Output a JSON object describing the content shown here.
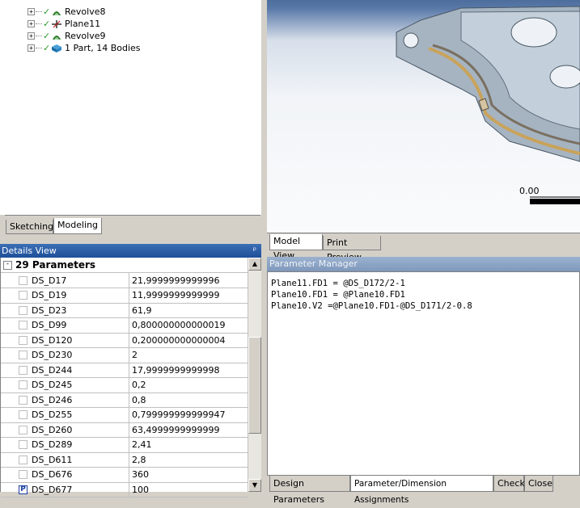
{
  "tree": {
    "items": [
      {
        "label": "Revolve8",
        "icon": "revolve-icon"
      },
      {
        "label": "Plane11",
        "icon": "plane-icon"
      },
      {
        "label": "Revolve9",
        "icon": "revolve-icon"
      },
      {
        "label": "1 Part, 14 Bodies",
        "icon": "parts-icon"
      }
    ]
  },
  "left_tabs": {
    "sketching": "Sketching",
    "modeling": "Modeling"
  },
  "details": {
    "title": "Details View",
    "group": "29 Parameters",
    "rows": [
      {
        "name": "DS_D17",
        "value": "21,9999999999996",
        "p": false
      },
      {
        "name": "DS_D19",
        "value": "11,9999999999999",
        "p": false
      },
      {
        "name": "DS_D23",
        "value": "61,9",
        "p": false
      },
      {
        "name": "DS_D99",
        "value": "0,800000000000019",
        "p": false
      },
      {
        "name": "DS_D120",
        "value": "0,200000000000004",
        "p": false
      },
      {
        "name": "DS_D230",
        "value": "2",
        "p": false
      },
      {
        "name": "DS_D244",
        "value": "17,9999999999998",
        "p": false
      },
      {
        "name": "DS_D245",
        "value": "0,2",
        "p": false
      },
      {
        "name": "DS_D246",
        "value": "0,8",
        "p": false
      },
      {
        "name": "DS_D255",
        "value": "0,799999999999947",
        "p": false
      },
      {
        "name": "DS_D260",
        "value": "63,4999999999999",
        "p": false
      },
      {
        "name": "DS_D289",
        "value": "2,41",
        "p": false
      },
      {
        "name": "DS_D611",
        "value": "2,8",
        "p": false
      },
      {
        "name": "DS_D676",
        "value": "360",
        "p": false
      },
      {
        "name": "DS_D677",
        "value": "100",
        "p": true
      }
    ]
  },
  "viewport": {
    "scale_label": "0.00"
  },
  "right_tabs": {
    "model_view": "Model View",
    "print_preview": "Print Preview"
  },
  "parameter_manager": {
    "title": "Parameter Manager",
    "lines": [
      "Plane11.FD1 = @DS_D172/2-1",
      "Plane10.FD1 = @Plane10.FD1",
      "Plane10.V2 =@Plane10.FD1-@DS_D171/2-0.8"
    ]
  },
  "bottom_tabs": {
    "design_parameters": "Design Parameters",
    "assignments": "Parameter/Dimension Assignments",
    "check": "Check",
    "close": "Close"
  },
  "colors": {
    "check_green": "#2a9b2a",
    "header_blue": "#1e4f99",
    "p_blue": "#1b3fa3"
  }
}
